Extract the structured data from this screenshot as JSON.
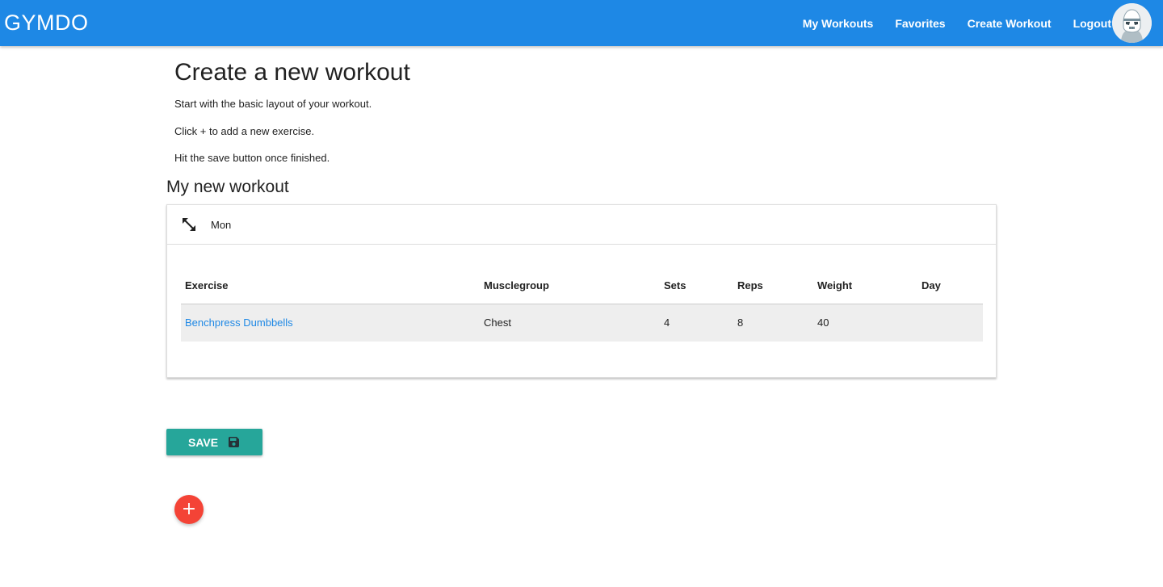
{
  "navbar": {
    "brand": "GYMDO",
    "links": [
      "My Workouts",
      "Favorites",
      "Create Workout",
      "Logout"
    ],
    "avatar_icon": "user-avatar-icon"
  },
  "intro": {
    "title": "Create a new workout",
    "lines": [
      "Start with the basic layout of your workout.",
      "Click + to add a new exercise.",
      "Hit the save button once finished."
    ]
  },
  "workout": {
    "name": "My new workout",
    "days": [
      {
        "label": "Mon",
        "expand_icon": "expand-arrows-icon",
        "columns": [
          "Exercise",
          "Musclegroup",
          "Sets",
          "Reps",
          "Weight",
          "Day"
        ],
        "rows": [
          [
            "Benchpress Dumbbells",
            "Chest",
            "4",
            "8",
            "40",
            ""
          ]
        ]
      }
    ]
  },
  "actions": {
    "save_label": "Save",
    "save_icon": "floppy-disk-icon",
    "add_icon": "plus-icon",
    "add_glyph": "+"
  },
  "colors": {
    "navbar": "#1e88e5",
    "link": "#1e88e5",
    "save_button": "#26a69a",
    "add_button": "#f44336"
  }
}
